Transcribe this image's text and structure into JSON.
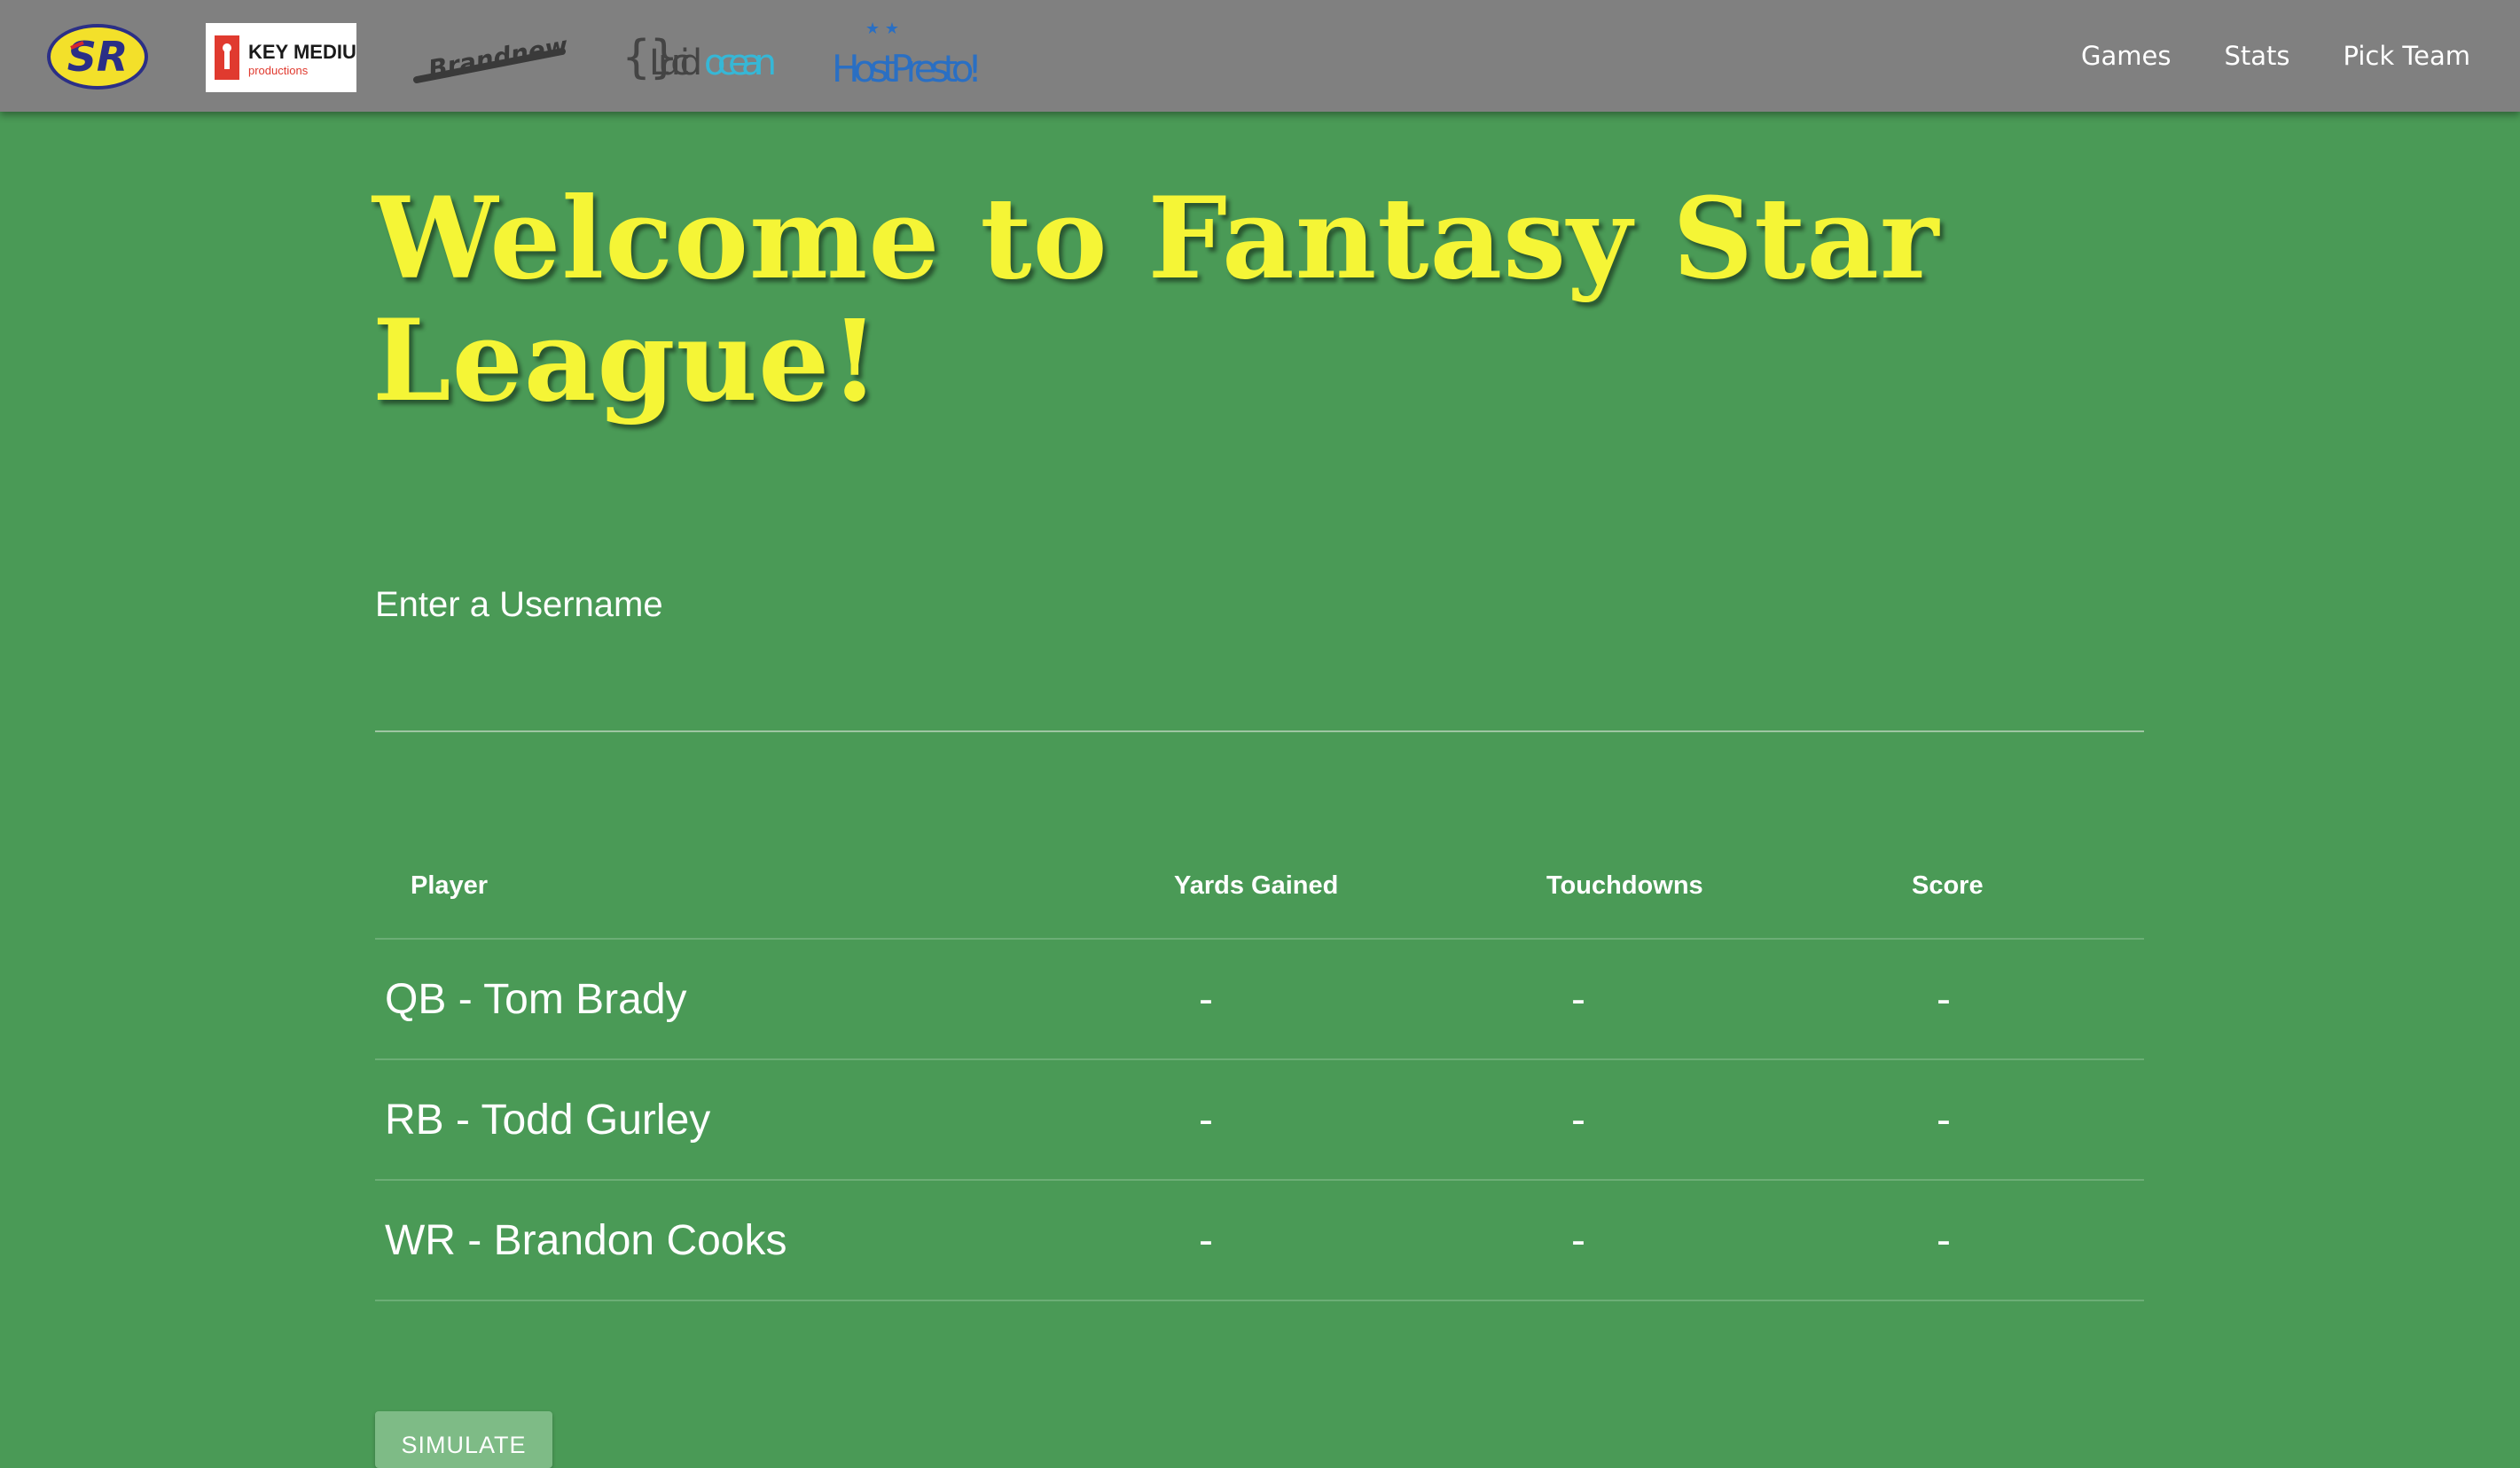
{
  "navbar": {
    "logos": [
      {
        "name": "sr-logo",
        "text": "SR",
        "colors": {
          "bg": "#f3e02a",
          "fg": "#2b2f86",
          "accent": "#d8262c"
        }
      },
      {
        "name": "keymedium-logo",
        "text": "KEY MEDIUM",
        "subtext": "productions",
        "colors": {
          "bg": "#ffffff",
          "fg": "#1a1a1a",
          "accent": "#e03a2f"
        }
      },
      {
        "name": "brandnewweb-logo",
        "text": "Brandnew web",
        "colors": {
          "fg": "#333333"
        }
      },
      {
        "name": "lucidocean-logo",
        "text_dark": "Lucid",
        "text_light": "ocean",
        "colors": {
          "dark": "#444444",
          "light": "#36b7d6"
        }
      },
      {
        "name": "hostpresto-logo",
        "text": "HostPresto!",
        "colors": {
          "fg": "#2a6fc3"
        }
      }
    ],
    "links": [
      "Games",
      "Stats",
      "Pick Team"
    ]
  },
  "main": {
    "headline": "Welcome to Fantasy Star League!",
    "username_label": "Enter a Username",
    "username_value": "",
    "table": {
      "headers": [
        "Player",
        "Yards Gained",
        "Touchdowns",
        "Score"
      ],
      "rows": [
        {
          "player": "QB - Tom Brady",
          "yards": "-",
          "touchdowns": "-",
          "score": "-"
        },
        {
          "player": "RB - Todd Gurley",
          "yards": "-",
          "touchdowns": "-",
          "score": "-"
        },
        {
          "player": "WR - Brandon Cooks",
          "yards": "-",
          "touchdowns": "-",
          "score": "-"
        }
      ]
    },
    "simulate_label": "SIMULATE"
  },
  "colors": {
    "page_bg": "#4a9a56",
    "navbar_bg": "#808080",
    "headline": "#f5f536",
    "button_bg": "#7ebb86"
  }
}
